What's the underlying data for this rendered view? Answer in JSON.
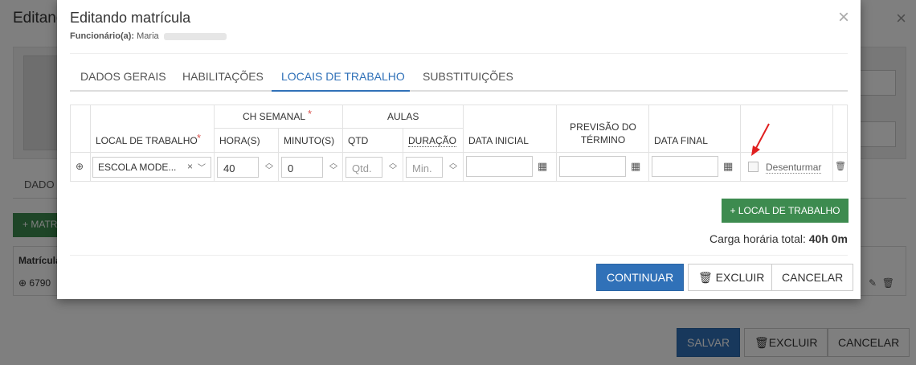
{
  "background": {
    "title": "Editando",
    "tab": "DADO",
    "add_button": "+ MATR",
    "table_header": "Matrícula",
    "row_value": "⊕ 6790",
    "buttons": {
      "save": "SALVAR",
      "delete": "EXCLUIR",
      "cancel": "CANCELAR"
    }
  },
  "modal": {
    "title": "Editando matrícula",
    "employee_label": "Funcionário(a):",
    "employee_name": "Maria",
    "tabs": [
      "DADOS GERAIS",
      "HABILITAÇÕES",
      "LOCAIS DE TRABALHO",
      "SUBSTITUIÇÕES"
    ],
    "active_tab": "LOCAIS DE TRABALHO",
    "table": {
      "group_headers": {
        "ch_semanal": "CH SEMANAL",
        "aulas": "AULAS"
      },
      "headers": {
        "local": "LOCAL DE TRABALHO",
        "horas": "HORA(S)",
        "minutos": "MINUTO(S)",
        "qtd": "QTD",
        "duracao": "DURAÇÃO",
        "data_inicial": "DATA INICIAL",
        "previsao": "PREVISÃO DO TÉRMINO",
        "data_final": "DATA FINAL"
      },
      "row": {
        "local": "ESCOLA MODE...",
        "horas": "40",
        "minutos": "0",
        "qtd_placeholder": "Qtd.",
        "duracao_placeholder": "Min.",
        "data_inicial": "",
        "previsao": "",
        "data_final": "",
        "desenturmar_label": "Desenturmar",
        "desenturmar_checked": false
      }
    },
    "add_local_button": "+ LOCAL DE TRABALHO",
    "carga_label": "Carga horária total:",
    "carga_value": "40h 0m",
    "buttons": {
      "continue": "CONTINUAR",
      "delete": "EXCLUIR",
      "cancel": "CANCELAR"
    },
    "colors": {
      "primary": "#3071b8",
      "success": "#3d8b4f",
      "required": "#d9534f",
      "arrow": "#e02020"
    }
  }
}
